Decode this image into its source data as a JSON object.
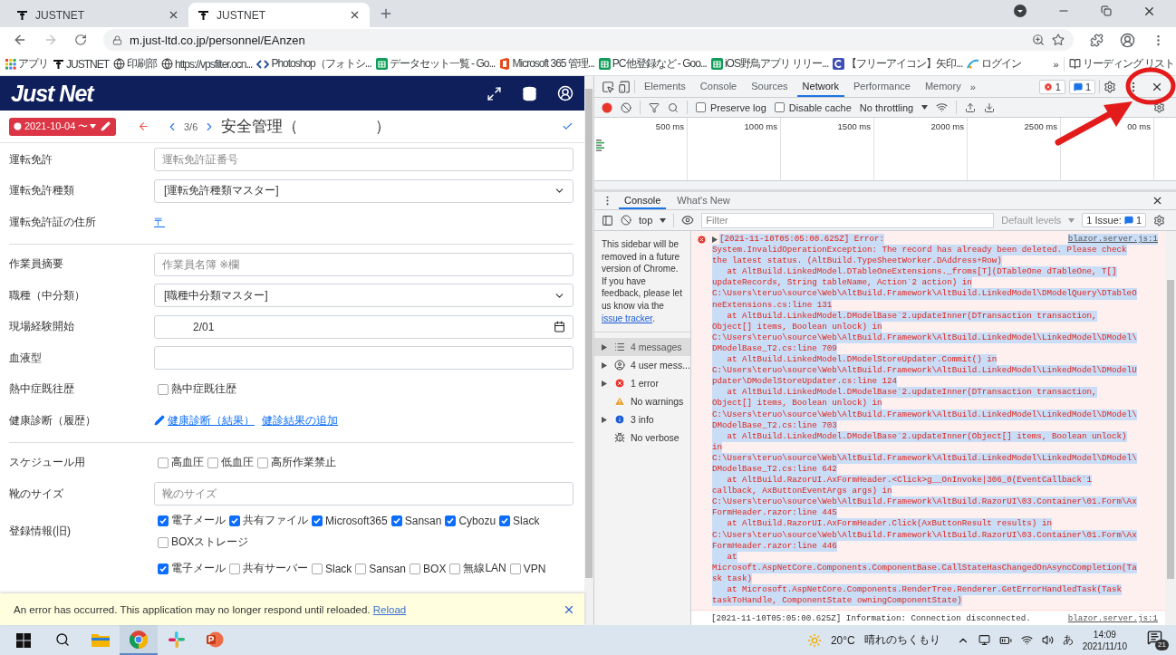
{
  "browser": {
    "tabs": [
      {
        "title": "JUSTNET",
        "selected": false
      },
      {
        "title": "JUSTNET",
        "selected": true
      }
    ],
    "url": "m.just-ltd.co.jp/personnel/EAnzen",
    "bookmarks": [
      {
        "label": "アプリ",
        "kind": "apps"
      },
      {
        "label": "JUSTNET",
        "kind": "site"
      },
      {
        "label": "印刷部",
        "kind": "globe"
      },
      {
        "label": "https://vpsfilter.ocn...",
        "kind": "globe"
      },
      {
        "label": "Photoshop（フォトシ...",
        "kind": "code"
      },
      {
        "label": "データセット一覧 - Go...",
        "kind": "sheets"
      },
      {
        "label": "Microsoft 365 管理...",
        "kind": "office"
      },
      {
        "label": "PC他登録など - Goo...",
        "kind": "sheets"
      },
      {
        "label": "iOS野鳥アプリ リリー...",
        "kind": "sheets"
      },
      {
        "label": "【フリーアイコン】矢印...",
        "kind": "custom"
      },
      {
        "label": "ログイン",
        "kind": "login"
      }
    ],
    "more": "»",
    "reading_list": "リーディング リスト"
  },
  "app": {
    "logo": "Just Net",
    "date_button": "2021-10-04 〜",
    "page": "3/6",
    "title": "安全管理（　　　　　）",
    "form": [
      {
        "kind": "input",
        "label": "運転免許",
        "placeholder": "運転免許証番号"
      },
      {
        "kind": "select",
        "label": "運転免許種類",
        "value": "[運転免許種類マスター]"
      },
      {
        "kind": "links",
        "label": "運転免許証の住所",
        "links": [
          {
            "text": "〒",
            "edit": false
          }
        ]
      },
      {
        "kind": "divider"
      },
      {
        "kind": "input",
        "label": "作業員摘要",
        "placeholder": "作業員名簿 ※欄"
      },
      {
        "kind": "select",
        "label": "職種（中分類）",
        "value": "[職種中分類マスター]"
      },
      {
        "kind": "date",
        "label": "現場経験開始",
        "value": "2/01"
      },
      {
        "kind": "input",
        "label": "血液型"
      },
      {
        "kind": "checks",
        "label": "熱中症既往歴",
        "options": [
          {
            "label": "熱中症既往歴",
            "checked": false
          }
        ]
      },
      {
        "kind": "links",
        "label": "健康診断（履歴）",
        "links": [
          {
            "text": "健康診断（結果）",
            "edit": true
          },
          {
            "text": "健診結果の追加",
            "edit": false
          }
        ]
      },
      {
        "kind": "divider"
      },
      {
        "kind": "checks",
        "label": "スケジュール用",
        "options": [
          {
            "label": "高血圧",
            "checked": false
          },
          {
            "label": "低血圧",
            "checked": false
          },
          {
            "label": "高所作業禁止",
            "checked": false
          }
        ]
      },
      {
        "kind": "input",
        "label": "靴のサイズ",
        "placeholder": "靴のサイズ"
      },
      {
        "kind": "checks",
        "label": "登録情報(旧)",
        "options": [
          {
            "label": "電子メール",
            "checked": true
          },
          {
            "label": "共有ファイル",
            "checked": true
          },
          {
            "label": "Microsoft365",
            "checked": true
          },
          {
            "label": "Sansan",
            "checked": true
          },
          {
            "label": "Cybozu",
            "checked": true
          },
          {
            "label": "Slack",
            "checked": true
          },
          {
            "label": "BOXストレージ",
            "checked": false
          }
        ]
      },
      {
        "kind": "checks",
        "options": [
          {
            "label": "電子メール",
            "checked": true
          },
          {
            "label": "共有サーバー",
            "checked": false
          },
          {
            "label": "Slack",
            "checked": false
          },
          {
            "label": "Sansan",
            "checked": false
          },
          {
            "label": "BOX",
            "checked": false
          },
          {
            "label": "無線LAN",
            "checked": false
          },
          {
            "label": "VPN",
            "checked": false
          }
        ]
      }
    ],
    "error_banner": {
      "text": "An error has occurred. This application may no longer respond until reloaded.",
      "link": "Reload"
    }
  },
  "devtools": {
    "tabs": [
      {
        "label": "Elements",
        "selected": false
      },
      {
        "label": "Console",
        "selected": false
      },
      {
        "label": "Sources",
        "selected": false
      },
      {
        "label": "Network",
        "selected": true
      },
      {
        "label": "Performance",
        "selected": false
      },
      {
        "label": "Memory",
        "selected": false
      }
    ],
    "more": "»",
    "error_count": "1",
    "message_count": "1",
    "preserve_log": {
      "label": "Preserve log",
      "checked": false
    },
    "disable_cache": {
      "label": "Disable cache",
      "checked": false
    },
    "throttling": "No throttling",
    "timeline_ticks": [
      "500 ms",
      "1000 ms",
      "1500 ms",
      "2000 ms",
      "2500 ms",
      "00 ms"
    ],
    "drawer_tabs": [
      {
        "label": "Console",
        "selected": true
      },
      {
        "label": "What's New",
        "selected": false
      }
    ],
    "context": "top",
    "filter_placeholder": "Filter",
    "levels": "Default levels",
    "issues_label": "1 Issue:",
    "issues_count": "1",
    "sidebar": {
      "notice": "This sidebar will be removed in a future version of Chrome. If you have feedback, please let us know via the",
      "notice_link": "issue tracker",
      "notice_end": ".",
      "items": [
        {
          "kind": "messages",
          "label": "4 messages",
          "selected": true,
          "expandable": true
        },
        {
          "kind": "user",
          "label": "4 user mess...",
          "selected": false,
          "expandable": true
        },
        {
          "kind": "error",
          "label": "1 error",
          "selected": false,
          "expandable": true
        },
        {
          "kind": "warning",
          "label": "No warnings",
          "selected": false,
          "expandable": false
        },
        {
          "kind": "info",
          "label": "3 info",
          "selected": false,
          "expandable": true
        },
        {
          "kind": "verbose",
          "label": "No verbose",
          "selected": false,
          "expandable": false
        }
      ]
    },
    "log": [
      {
        "kind": "error",
        "header": "[2021-11-10T05:05:00.625Z] Error:",
        "source": "blazor.server.js:1",
        "lines": [
          "System.InvalidOperationException: The record has already been deleted. Please check",
          "the latest status. (AltBuild.TypeSheetWorker.DAddress+Row)",
          "   at AltBuild.LinkedModel.DTableOneExtensions._froms[T](DTableOne dTableOne, T[]",
          "updateRecords, String tableName, Action`2 action) in",
          "C:\\Users\\teruo\\source\\Web\\AltBuild.Framework\\AltBuild.LinkedModel\\DModelQuery\\DTableO",
          "neExtensions.cs:line 131",
          "   at AltBuild.LinkedModel.DModelBase`2.updateInner(DTransaction transaction,",
          "Object[] items, Boolean unlock) in",
          "C:\\Users\\teruo\\source\\Web\\AltBuild.Framework\\AltBuild.LinkedModel\\LinkedModel\\DModel\\",
          "DModelBase_T2.cs:line 709",
          "   at AltBuild.LinkedModel.DModelStoreUpdater.Commit() in",
          "C:\\Users\\teruo\\source\\Web\\AltBuild.Framework\\AltBuild.LinkedModel\\LinkedModel\\DModelU",
          "pdater\\DModelStoreUpdater.cs:line 124",
          "   at AltBuild.LinkedModel.DModelBase`2.updateInner(DTransaction transaction,",
          "Object[] items, Boolean unlock) in",
          "C:\\Users\\teruo\\source\\Web\\AltBuild.Framework\\AltBuild.LinkedModel\\LinkedModel\\DModel\\",
          "DModelBase_T2.cs:line 703",
          "   at AltBuild.LinkedModel.DModelBase`2.updateInner(Object[] items, Boolean unlock)",
          "in",
          "C:\\Users\\teruo\\source\\Web\\AltBuild.Framework\\AltBuild.LinkedModel\\LinkedModel\\DModel\\",
          "DModelBase_T2.cs:line 642",
          "   at AltBuild.RazorUI.AxFormHeader.<Click>g__OnInvoke|306_0(EventCallback`1",
          "callback, AxButtonEventArgs args) in",
          "C:\\Users\\teruo\\source\\Web\\AltBuild.Framework\\AltBuild.RazorUI\\03.Container\\01.Form\\Ax",
          "FormHeader.razor:line 445",
          "   at AltBuild.RazorUI.AxFormHeader.Click(AxButtonResult results) in",
          "C:\\Users\\teruo\\source\\Web\\AltBuild.Framework\\AltBuild.RazorUI\\03.Container\\01.Form\\Ax",
          "FormHeader.razor:line 446",
          "   at",
          "Microsoft.AspNetCore.Components.ComponentBase.CallStateHasChangedOnAsyncCompletion(Ta",
          "sk task)",
          "   at Microsoft.AspNetCore.Components.RenderTree.Renderer.GetErrorHandledTask(Task",
          "taskToHandle, ComponentState owningComponentState)"
        ]
      },
      {
        "kind": "info",
        "header": "[2021-11-10T05:05:00.625Z] Information: Connection disconnected.",
        "source": "blazor.server.js:1"
      }
    ]
  },
  "taskbar": {
    "apps": [
      {
        "kind": "explorer",
        "active": false
      },
      {
        "kind": "chrome",
        "active": true
      },
      {
        "kind": "slack",
        "active": false
      },
      {
        "kind": "powerpoint",
        "active": false
      }
    ],
    "temperature": "20°C",
    "weather": "晴れのちくもり",
    "ime": "あ",
    "time": "14:09",
    "date": "2021/11/10",
    "notifications": "21"
  }
}
